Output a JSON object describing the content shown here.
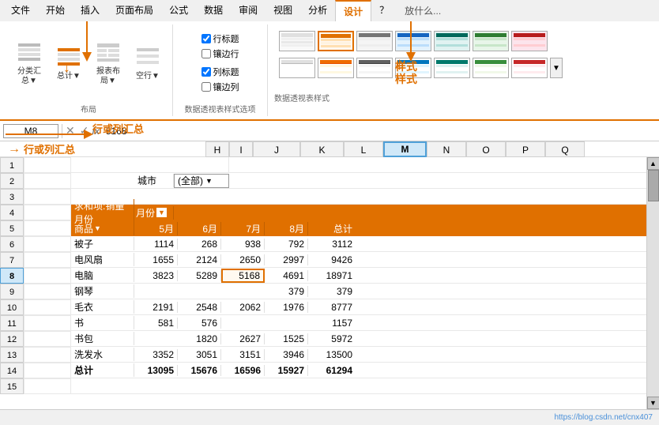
{
  "ribbon": {
    "tabs": [
      "文件",
      "开始",
      "插入",
      "页面布局",
      "公式",
      "数据",
      "审阅",
      "视图",
      "分析",
      "设计",
      "？"
    ],
    "active_tab": "设计",
    "groups": {
      "layout": {
        "label": "布局",
        "buttons": [
          {
            "id": "subtotal",
            "label": "分类汇\n总▼",
            "icon": "subtotal"
          },
          {
            "id": "grandtotal",
            "label": "总计▼",
            "icon": "grandtotal"
          },
          {
            "id": "report",
            "label": "报表布\n局▼",
            "icon": "report"
          },
          {
            "id": "blank",
            "label": "空行▼",
            "icon": "blank"
          }
        ]
      },
      "options": {
        "label": "数据透视表样式选项",
        "checkboxes": [
          {
            "id": "row_header",
            "label": "行标题",
            "checked": true
          },
          {
            "id": "banded_rows",
            "label": "镶边行",
            "checked": false
          },
          {
            "id": "col_header",
            "label": "列标题",
            "checked": true
          },
          {
            "id": "banded_cols",
            "label": "镶边列",
            "checked": false
          }
        ]
      },
      "styles": {
        "label": "数据透视表样式"
      }
    }
  },
  "formula_bar": {
    "name_box": "M8",
    "formula": "5168",
    "fx": "fx"
  },
  "annotation_style": "样式",
  "annotation_row_col": "行或列汇总",
  "sheet": {
    "col_headers": [
      "H",
      "I",
      "J",
      "K",
      "L",
      "M",
      "N",
      "O",
      "P",
      "Q"
    ],
    "row_count": 15,
    "city_label": "城市",
    "city_value": "(全部)",
    "pivot": {
      "title": "求和项:销量  月份",
      "headers": [
        "商品",
        "5月",
        "6月",
        "7月",
        "8月",
        "总计"
      ],
      "rows": [
        {
          "product": "被子",
          "m5": 1114,
          "m6": 268,
          "m7": 938,
          "m8": 792,
          "total": 3112
        },
        {
          "product": "电风扇",
          "m5": 1655,
          "m6": 2124,
          "m7": 2650,
          "m8": 2997,
          "total": 9426
        },
        {
          "product": "电脑",
          "m5": 3823,
          "m6": 5289,
          "m7": 5168,
          "m8": 4691,
          "total": 18971
        },
        {
          "product": "钢琴",
          "m5": "",
          "m6": "",
          "m7": "",
          "m8": 379,
          "total": 379
        },
        {
          "product": "毛衣",
          "m5": 2191,
          "m6": 2548,
          "m7": 2062,
          "m8": 1976,
          "total": 8777
        },
        {
          "product": "书",
          "m5": 581,
          "m6": 576,
          "m7": "",
          "m8": "",
          "total": 1157
        },
        {
          "product": "书包",
          "m5": "",
          "m6": 1820,
          "m7": 2627,
          "m8": 1525,
          "total": 5972
        },
        {
          "product": "洗发水",
          "m5": 3352,
          "m6": 3051,
          "m7": 3151,
          "m8": 3946,
          "total": 13500
        },
        {
          "product": "总计",
          "m5": 13095,
          "m6": 15676,
          "m7": 16596,
          "m8": 15927,
          "total": 61294
        }
      ]
    }
  },
  "styles_swatches": [
    {
      "colors": [
        "#f5f5f5",
        "#e0e0e0",
        "#f5f5f5"
      ],
      "selected": false
    },
    {
      "colors": [
        "#fff3e0",
        "#e07000",
        "#fff3e0"
      ],
      "selected": true
    },
    {
      "colors": [
        "#e3f2fd",
        "#1565c0",
        "#e3f2fd"
      ],
      "selected": false
    },
    {
      "colors": [
        "#e8f5e9",
        "#2e7d32",
        "#e8f5e9"
      ],
      "selected": false
    },
    {
      "colors": [
        "#fce4ec",
        "#880e4f",
        "#fce4ec"
      ],
      "selected": false
    },
    {
      "colors": [
        "#f3e5f5",
        "#6a1b9a",
        "#f3e5f5"
      ],
      "selected": false
    }
  ]
}
